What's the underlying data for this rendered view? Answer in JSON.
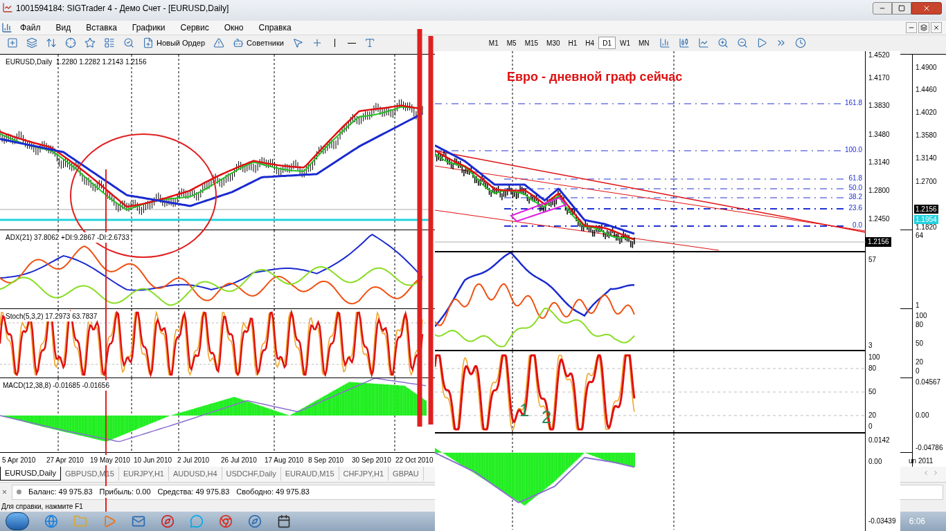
{
  "window": {
    "title": "1001594184: SIGTrader 4 - Демо Счет - [EURUSD,Daily]"
  },
  "menu": [
    "Файл",
    "Вид",
    "Вставка",
    "Графики",
    "Сервис",
    "Окно",
    "Справка"
  ],
  "toolbar": {
    "new_order": "Новый Ордер",
    "experts": "Советники",
    "timeframes": [
      {
        "label": "M1",
        "selected": false
      },
      {
        "label": "M5",
        "selected": false
      },
      {
        "label": "M15",
        "selected": false
      },
      {
        "label": "M30",
        "selected": false
      },
      {
        "label": "H1",
        "selected": false
      },
      {
        "label": "H4",
        "selected": false
      },
      {
        "label": "D1",
        "selected": true
      },
      {
        "label": "W1",
        "selected": false
      },
      {
        "label": "MN",
        "selected": false
      }
    ]
  },
  "chart": {
    "price_legend": "EURUSD,Daily  1.2280 1.2282 1.2143 1.2156",
    "adx_legend": "ADX(21) 37.8062 +DI:9.2867 -DI:2.6733",
    "stoch_legend": "Stoch(5,3,2) 17.2973 63.7837",
    "macd_legend": "MACD(12,38,8) -0.01685 -0.01656",
    "dates": [
      "5 Apr 2010",
      "27 Apr 2010",
      "19 May 2010",
      "10 Jun 2010",
      "2 Jul 2010",
      "26 Jul 2010",
      "17 Aug 2010",
      "8 Sep 2010",
      "30 Sep 2010",
      "22 Oct 2010"
    ],
    "price_axis": [
      "1.4900",
      "1.4460",
      "1.4020",
      "1.3580",
      "1.3140",
      "1.2700"
    ],
    "bid": "1.2156",
    "line_price": "1.1954",
    "low_price": "1.1820",
    "adx_axis": [
      "64",
      "1"
    ],
    "stoch_axis": [
      "100",
      "80",
      "50",
      "20",
      "0"
    ],
    "macd_axis": [
      "0.04567",
      "0.00",
      "-0.04786"
    ],
    "last_date": "un 2011"
  },
  "symbol_tabs": [
    {
      "label": "EURUSD,Daily",
      "selected": true
    },
    {
      "label": "GBPUSD,M15",
      "selected": false
    },
    {
      "label": "EURJPY,H1",
      "selected": false
    },
    {
      "label": "AUDUSD,H4",
      "selected": false
    },
    {
      "label": "USDCHF,Daily",
      "selected": false
    },
    {
      "label": "EURAUD,M15",
      "selected": false
    },
    {
      "label": "CHFJPY,H1",
      "selected": false
    },
    {
      "label": "GBPAU",
      "selected": false
    }
  ],
  "account": [
    "Баланс: 49 975.83",
    "Прибыль: 0.00",
    "Средства: 49 975.83",
    "Свободно: 49 975.83"
  ],
  "help_text": "Для справки, нажмите F1",
  "taskbar": {
    "clock": "6:06"
  },
  "pasted_chart": {
    "title": "Евро - дневной граф сейчас",
    "price_axis": [
      "1.4520",
      "1.4170",
      "1.3830",
      "1.3480",
      "1.3140",
      "1.2800",
      "1.2450"
    ],
    "bid": "1.2156",
    "fib_levels": [
      "161.8",
      "100.0",
      "61.8",
      "50.0",
      "38.2",
      "23.6",
      "0.0"
    ],
    "adx_axis": [
      "57",
      "3"
    ],
    "stoch_axis": [
      "100",
      "80",
      "50",
      "20",
      "0"
    ],
    "macd_axis": [
      "0.0142",
      "0.00",
      "-0.03439"
    ],
    "marks": [
      "1",
      "2"
    ]
  }
}
